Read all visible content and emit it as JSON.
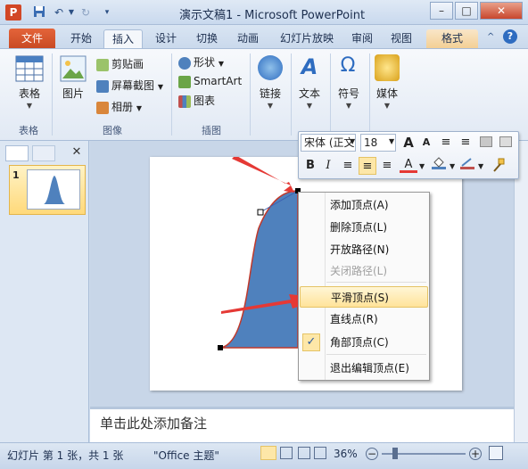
{
  "window": {
    "title": "演示文稿1 - Microsoft PowerPoint",
    "app_icon_letter": "P",
    "min": "–",
    "max": "□",
    "close": "✕"
  },
  "tabs": {
    "file": "文件",
    "items": [
      "开始",
      "插入",
      "设计",
      "切换",
      "动画",
      "幻灯片放映",
      "审阅",
      "视图",
      "格式"
    ]
  },
  "ribbon": {
    "table": {
      "label": "表格",
      "group": "表格"
    },
    "picture": {
      "label": "图片"
    },
    "clipart": "剪贴画",
    "screenshot": "屏幕截图",
    "album": "相册",
    "image_group": "图像",
    "shapes": "形状",
    "smartart": "SmartArt",
    "chart": "图表",
    "illustrations_group": "插图",
    "link": "链接",
    "text": "文本",
    "symbol": "符号",
    "media": "媒体"
  },
  "minitoolbar": {
    "font": "宋体 (正文",
    "size": "18",
    "bold": "B",
    "italic": "I",
    "font_color_letter": "A"
  },
  "context_menu": {
    "add_vertex": "添加顶点(A)",
    "delete_vertex": "删除顶点(L)",
    "open_path": "开放路径(N)",
    "close_path": "关闭路径(L)",
    "smooth_point": "平滑顶点(S)",
    "straight_point": "直线点(R)",
    "corner_point": "角部顶点(C)",
    "exit_edit": "退出编辑顶点(E)",
    "check": "✓"
  },
  "thumbnail": {
    "number": "1"
  },
  "notes": {
    "placeholder": "单击此处添加备注"
  },
  "status": {
    "slide_info": "幻灯片 第 1 张，共 1 张",
    "theme": "\"Office 主题\"",
    "zoom": "36%"
  },
  "colors": {
    "accent": "#d24726",
    "shape_fill": "#4f81bd",
    "arrow": "#e53935",
    "menu_highlight": "#ffe39a"
  }
}
